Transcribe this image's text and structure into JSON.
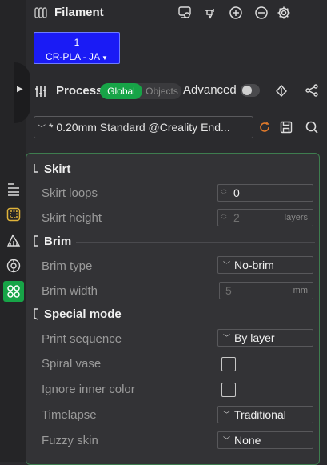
{
  "filament": {
    "title": "Filament",
    "chip": {
      "index": "1",
      "name": "CR-PLA - JA",
      "color": "#1a1bf5"
    }
  },
  "process": {
    "title": "Process",
    "toggle": {
      "global": "Global",
      "objects": "Objects",
      "selected": "Global"
    },
    "advanced_label": "Advanced",
    "advanced_on": false,
    "preset": "* 0.20mm Standard @Creality End..."
  },
  "side_tabs": [
    "quality-icon",
    "strength-icon",
    "support-icon",
    "filament-icon",
    "others-icon"
  ],
  "sections": {
    "skirt": {
      "title": "Skirt",
      "rows": {
        "loops": {
          "label": "Skirt loops",
          "value": "0"
        },
        "height": {
          "label": "Skirt height",
          "value": "2",
          "unit": "layers"
        }
      }
    },
    "brim": {
      "title": "Brim",
      "rows": {
        "type": {
          "label": "Brim type",
          "value": "No-brim"
        },
        "width": {
          "label": "Brim width",
          "value": "5",
          "unit": "mm"
        }
      }
    },
    "special": {
      "title": "Special mode",
      "rows": {
        "sequence": {
          "label": "Print sequence",
          "value": "By layer"
        },
        "spiral": {
          "label": "Spiral vase",
          "checked": false
        },
        "ignore_color": {
          "label": "Ignore inner color",
          "checked": false
        },
        "timelapse": {
          "label": "Timelapse",
          "value": "Traditional"
        },
        "fuzzy": {
          "label": "Fuzzy skin",
          "value": "None"
        }
      }
    }
  },
  "colors": {
    "accent": "#17a447",
    "panel_border": "#3e7d4f",
    "refresh": "#e07a2b"
  }
}
